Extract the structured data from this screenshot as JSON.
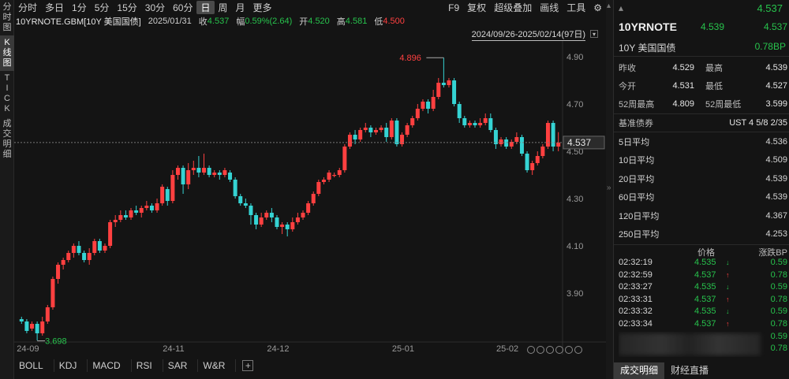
{
  "rail": {
    "tabs": [
      {
        "label": [
          "分",
          "时",
          "图"
        ],
        "active": false
      },
      {
        "label": [
          "K",
          "线",
          "图"
        ],
        "active": true
      },
      {
        "label": [
          "T",
          "I",
          "C",
          "K"
        ],
        "active": false
      },
      {
        "label": [
          "成",
          "交",
          "明",
          "细"
        ],
        "active": false
      }
    ]
  },
  "toolbar": {
    "periods": [
      "分时",
      "多日",
      "1分",
      "5分",
      "15分",
      "30分",
      "60分",
      "日",
      "周",
      "月",
      "更多"
    ],
    "active_period": "日",
    "tools": [
      "F9",
      "复权",
      "超级叠加",
      "画线",
      "工具"
    ],
    "settings_icon": "gear-icon"
  },
  "info": {
    "symbol": "10YRNOTE.GBM[10Y 美国国债]",
    "date": "2025/01/31",
    "close_label": "收",
    "close": "4.537",
    "change_label": "幅",
    "change": "0.59%(2.64)",
    "open_label": "开",
    "open": "4.520",
    "high_label": "高",
    "high": "4.581",
    "low_label": "低",
    "low": "4.500"
  },
  "range_label": "2024/09/26-2025/02/14(97日)",
  "indicators": [
    "BOLL",
    "KDJ",
    "MACD",
    "RSI",
    "SAR",
    "W&R"
  ],
  "colors": {
    "up": "#ff4040",
    "down": "#35d3d3",
    "green_text": "#27c24c"
  },
  "chart_data": {
    "type": "candlestick",
    "ylim": [
      3.7,
      4.95
    ],
    "yticks": [
      "4.90",
      "4.70",
      "4.50",
      "4.30",
      "4.10",
      "3.90"
    ],
    "ytick_values": [
      4.9,
      4.7,
      4.5,
      4.3,
      4.1,
      3.9
    ],
    "xticks": [
      "24-09",
      "24-11",
      "24-12",
      "25-01",
      "25-02"
    ],
    "xtick_index": [
      0,
      28,
      48,
      72,
      92
    ],
    "current_price": "4.537",
    "current_value": 4.537,
    "max_label": "4.896",
    "max_value": 4.896,
    "min_label": "3.698",
    "min_value": 3.698,
    "candles": [
      [
        3.79,
        3.78,
        3.8,
        3.77
      ],
      [
        3.78,
        3.74,
        3.79,
        3.73
      ],
      [
        3.75,
        3.77,
        3.78,
        3.74
      ],
      [
        3.77,
        3.73,
        3.78,
        3.7
      ],
      [
        3.73,
        3.78,
        3.8,
        3.72
      ],
      [
        3.78,
        3.84,
        3.85,
        3.77
      ],
      [
        3.84,
        3.96,
        3.97,
        3.83
      ],
      [
        3.96,
        4.02,
        4.03,
        3.94
      ],
      [
        4.02,
        4.04,
        4.05,
        4.0
      ],
      [
        4.04,
        4.07,
        4.08,
        4.03
      ],
      [
        4.07,
        4.1,
        4.11,
        4.05
      ],
      [
        4.1,
        4.07,
        4.12,
        4.06
      ],
      [
        4.07,
        4.04,
        4.08,
        4.03
      ],
      [
        4.04,
        4.07,
        4.09,
        4.02
      ],
      [
        4.07,
        4.12,
        4.13,
        4.06
      ],
      [
        4.12,
        4.08,
        4.13,
        4.07
      ],
      [
        4.08,
        4.1,
        4.11,
        4.07
      ],
      [
        4.1,
        4.2,
        4.21,
        4.09
      ],
      [
        4.2,
        4.21,
        4.23,
        4.18
      ],
      [
        4.21,
        4.23,
        4.25,
        4.2
      ],
      [
        4.23,
        4.22,
        4.25,
        4.21
      ],
      [
        4.22,
        4.25,
        4.26,
        4.21
      ],
      [
        4.25,
        4.24,
        4.27,
        4.23
      ],
      [
        4.24,
        4.26,
        4.27,
        4.22
      ],
      [
        4.26,
        4.27,
        4.29,
        4.25
      ],
      [
        4.27,
        4.25,
        4.28,
        4.24
      ],
      [
        4.25,
        4.28,
        4.3,
        4.24
      ],
      [
        4.28,
        4.35,
        4.36,
        4.27
      ],
      [
        4.34,
        4.29,
        4.35,
        4.27
      ],
      [
        4.29,
        4.4,
        4.42,
        4.28
      ],
      [
        4.4,
        4.43,
        4.44,
        4.38
      ],
      [
        4.43,
        4.36,
        4.44,
        4.32
      ],
      [
        4.36,
        4.42,
        4.45,
        4.34
      ],
      [
        4.42,
        4.43,
        4.46,
        4.4
      ],
      [
        4.43,
        4.41,
        4.48,
        4.39
      ],
      [
        4.41,
        4.43,
        4.49,
        4.4
      ],
      [
        4.43,
        4.4,
        4.44,
        4.39
      ],
      [
        4.4,
        4.41,
        4.42,
        4.39
      ],
      [
        4.41,
        4.4,
        4.42,
        4.38
      ],
      [
        4.4,
        4.42,
        4.43,
        4.39
      ],
      [
        4.41,
        4.38,
        4.42,
        4.37
      ],
      [
        4.38,
        4.31,
        4.39,
        4.3
      ],
      [
        4.31,
        4.28,
        4.32,
        4.27
      ],
      [
        4.28,
        4.27,
        4.3,
        4.26
      ],
      [
        4.27,
        4.23,
        4.28,
        4.19
      ],
      [
        4.23,
        4.19,
        4.24,
        4.17
      ],
      [
        4.19,
        4.22,
        4.24,
        4.18
      ],
      [
        4.22,
        4.24,
        4.25,
        4.21
      ],
      [
        4.24,
        4.22,
        4.26,
        4.2
      ],
      [
        4.22,
        4.18,
        4.23,
        4.17
      ],
      [
        4.18,
        4.19,
        4.2,
        4.15
      ],
      [
        4.19,
        4.17,
        4.2,
        4.14
      ],
      [
        4.17,
        4.2,
        4.22,
        4.16
      ],
      [
        4.2,
        4.22,
        4.24,
        4.19
      ],
      [
        4.22,
        4.24,
        4.25,
        4.21
      ],
      [
        4.24,
        4.28,
        4.29,
        4.23
      ],
      [
        4.28,
        4.32,
        4.33,
        4.27
      ],
      [
        4.32,
        4.37,
        4.38,
        4.31
      ],
      [
        4.37,
        4.38,
        4.39,
        4.36
      ],
      [
        4.38,
        4.41,
        4.42,
        4.37
      ],
      [
        4.4,
        4.4,
        4.41,
        4.39
      ],
      [
        4.4,
        4.42,
        4.43,
        4.39
      ],
      [
        4.42,
        4.52,
        4.53,
        4.41
      ],
      [
        4.52,
        4.57,
        4.58,
        4.51
      ],
      [
        4.57,
        4.55,
        4.59,
        4.53
      ],
      [
        4.55,
        4.59,
        4.6,
        4.54
      ],
      [
        4.59,
        4.6,
        4.62,
        4.58
      ],
      [
        4.6,
        4.58,
        4.61,
        4.56
      ],
      [
        4.58,
        4.59,
        4.6,
        4.57
      ],
      [
        4.59,
        4.6,
        4.61,
        4.58
      ],
      [
        4.6,
        4.56,
        4.62,
        4.54
      ],
      [
        4.56,
        4.63,
        4.64,
        4.55
      ],
      [
        4.63,
        4.53,
        4.64,
        4.52
      ],
      [
        4.53,
        4.57,
        4.58,
        4.52
      ],
      [
        4.57,
        4.61,
        4.62,
        4.56
      ],
      [
        4.61,
        4.64,
        4.65,
        4.6
      ],
      [
        4.64,
        4.68,
        4.7,
        4.63
      ],
      [
        4.68,
        4.71,
        4.72,
        4.67
      ],
      [
        4.71,
        4.68,
        4.72,
        4.66
      ],
      [
        4.68,
        4.73,
        4.76,
        4.67
      ],
      [
        4.73,
        4.79,
        4.81,
        4.72
      ],
      [
        4.79,
        4.78,
        4.896,
        4.77
      ],
      [
        4.78,
        4.8,
        4.81,
        4.77
      ],
      [
        4.8,
        4.7,
        4.81,
        4.69
      ],
      [
        4.7,
        4.64,
        4.71,
        4.62
      ],
      [
        4.64,
        4.61,
        4.65,
        4.6
      ],
      [
        4.61,
        4.62,
        4.63,
        4.6
      ],
      [
        4.62,
        4.61,
        4.63,
        4.6
      ],
      [
        4.61,
        4.62,
        4.64,
        4.6
      ],
      [
        4.62,
        4.64,
        4.66,
        4.61
      ],
      [
        4.64,
        4.59,
        4.66,
        4.58
      ],
      [
        4.59,
        4.53,
        4.6,
        4.51
      ],
      [
        4.53,
        4.55,
        4.56,
        4.52
      ],
      [
        4.55,
        4.52,
        4.56,
        4.51
      ],
      [
        4.52,
        4.54,
        4.55,
        4.51
      ],
      [
        4.54,
        4.56,
        4.58,
        4.53
      ],
      [
        4.56,
        4.49,
        4.57,
        4.48
      ],
      [
        4.49,
        4.42,
        4.5,
        4.41
      ],
      [
        4.42,
        4.45,
        4.46,
        4.4
      ],
      [
        4.45,
        4.48,
        4.5,
        4.44
      ],
      [
        4.48,
        4.52,
        4.53,
        4.47
      ],
      [
        4.52,
        4.62,
        4.63,
        4.51
      ],
      [
        4.62,
        4.52,
        4.63,
        4.5
      ],
      [
        4.52,
        4.537,
        4.581,
        4.5
      ]
    ]
  },
  "panel": {
    "price_top": "4.537",
    "title": "10YRNOTE",
    "bid": "4.539",
    "ask": "4.537",
    "name": "10Y 美国国债",
    "change_bp": "0.78BP",
    "stats": [
      {
        "k": "昨收",
        "v": "4.529",
        "vc": "w",
        "k2": "最高",
        "v2": "4.539",
        "v2c": "g"
      },
      {
        "k": "今开",
        "v": "4.531",
        "vc": "g",
        "k2": "最低",
        "v2": "4.527",
        "v2c": "r"
      },
      {
        "k": "52周最高",
        "v": "4.809",
        "vc": "w",
        "k2": "52周最低",
        "v2": "3.599",
        "v2c": "w"
      }
    ],
    "bond_label": "基准债券",
    "bond_value": "UST 4 5/8 2/35",
    "ma": [
      {
        "k": "5日平均",
        "v": "4.536"
      },
      {
        "k": "10日平均",
        "v": "4.509"
      },
      {
        "k": "20日平均",
        "v": "4.539"
      },
      {
        "k": "60日平均",
        "v": "4.539"
      },
      {
        "k": "120日平均",
        "v": "4.367"
      },
      {
        "k": "250日平均",
        "v": "4.253"
      }
    ],
    "ticks_header": {
      "price": "价格",
      "bp": "涨跌BP"
    },
    "ticks": [
      {
        "t": "02:32:19",
        "p": "4.535",
        "dir": "down",
        "bp": "0.59"
      },
      {
        "t": "02:32:59",
        "p": "4.537",
        "dir": "up",
        "bp": "0.78"
      },
      {
        "t": "02:33:27",
        "p": "4.535",
        "dir": "down",
        "bp": "0.59"
      },
      {
        "t": "02:33:31",
        "p": "4.537",
        "dir": "up",
        "bp": "0.78"
      },
      {
        "t": "02:33:32",
        "p": "4.535",
        "dir": "down",
        "bp": "0.59"
      },
      {
        "t": "02:33:34",
        "p": "4.537",
        "dir": "up",
        "bp": "0.78"
      }
    ],
    "blurred_bp": [
      "0.59",
      "0.78"
    ],
    "bottom_tabs": [
      "成交明细",
      "财经直播"
    ],
    "active_bottom_tab": "成交明细"
  }
}
